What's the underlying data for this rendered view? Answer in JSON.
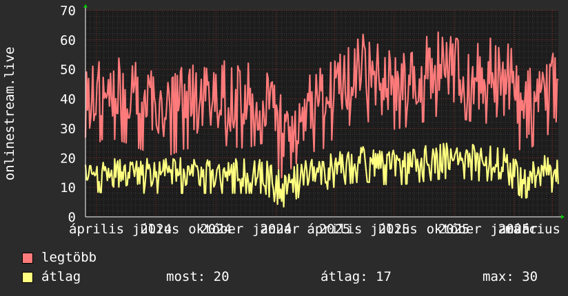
{
  "chart_data": {
    "type": "line",
    "ylabel": "onlinestream.live",
    "ylim": [
      0,
      70
    ],
    "yticks": [
      0,
      10,
      20,
      30,
      40,
      50,
      60,
      70
    ],
    "xlim": [
      "2024-03-15",
      "2026-03-10"
    ],
    "x_ticks": [
      {
        "date": "2024-04-01",
        "label": "április"
      },
      {
        "date": "2024-07-01",
        "label": "július"
      },
      {
        "date": "2024-07-01",
        "label": "2024"
      },
      {
        "date": "2024-10-01",
        "label": "október"
      },
      {
        "date": "2024-10-01",
        "label": "2024"
      },
      {
        "date": "2025-01-01",
        "label": "január"
      },
      {
        "date": "2025-01-01",
        "label": "2024"
      },
      {
        "date": "2025-04-01",
        "label": "április"
      },
      {
        "date": "2025-04-01",
        "label": "2025"
      },
      {
        "date": "2025-07-01",
        "label": "július"
      },
      {
        "date": "2025-07-01",
        "label": "2025"
      },
      {
        "date": "2025-10-01",
        "label": "október"
      },
      {
        "date": "2025-10-01",
        "label": "2025"
      },
      {
        "date": "2026-01-01",
        "label": "január"
      },
      {
        "date": "2026-01-01",
        "label": "2025"
      },
      {
        "date": "2026-03-01",
        "label": "március 2026"
      }
    ],
    "grid": true,
    "legend_placement": "bottom-left",
    "series": [
      {
        "name": "legtöbb",
        "color": "#ff7b7b",
        "points": [
          [
            "2024-03-15",
            38
          ],
          [
            "2024-04-15",
            44
          ],
          [
            "2024-05-15",
            42
          ],
          [
            "2024-06-15",
            39
          ],
          [
            "2024-07-15",
            37
          ],
          [
            "2024-08-15",
            40
          ],
          [
            "2024-09-15",
            39
          ],
          [
            "2024-10-15",
            41
          ],
          [
            "2024-11-15",
            40
          ],
          [
            "2024-12-15",
            42
          ],
          [
            "2025-01-10",
            30
          ],
          [
            "2025-02-15",
            38
          ],
          [
            "2025-03-15",
            40
          ],
          [
            "2025-04-15",
            47
          ],
          [
            "2025-05-15",
            50
          ],
          [
            "2025-06-15",
            46
          ],
          [
            "2025-07-15",
            47
          ],
          [
            "2025-08-15",
            49
          ],
          [
            "2025-09-15",
            52
          ],
          [
            "2025-10-15",
            50
          ],
          [
            "2025-11-15",
            48
          ],
          [
            "2025-12-15",
            52
          ],
          [
            "2026-01-15",
            37
          ],
          [
            "2026-02-15",
            45
          ],
          [
            "2026-03-10",
            44
          ]
        ]
      },
      {
        "name": "átlag",
        "color": "#ffff80",
        "points": [
          [
            "2024-03-15",
            16
          ],
          [
            "2024-04-15",
            15
          ],
          [
            "2024-05-15",
            15
          ],
          [
            "2024-06-15",
            15
          ],
          [
            "2024-07-15",
            15
          ],
          [
            "2024-08-15",
            15
          ],
          [
            "2024-09-15",
            15
          ],
          [
            "2024-10-15",
            15
          ],
          [
            "2024-11-15",
            15
          ],
          [
            "2024-12-15",
            15
          ],
          [
            "2025-01-10",
            10
          ],
          [
            "2025-02-15",
            15
          ],
          [
            "2025-03-15",
            16
          ],
          [
            "2025-04-15",
            18
          ],
          [
            "2025-05-15",
            19
          ],
          [
            "2025-06-15",
            18
          ],
          [
            "2025-07-15",
            18
          ],
          [
            "2025-08-15",
            19
          ],
          [
            "2025-09-15",
            20
          ],
          [
            "2025-10-15",
            20
          ],
          [
            "2025-11-15",
            19
          ],
          [
            "2025-12-15",
            20
          ],
          [
            "2026-01-15",
            13
          ],
          [
            "2026-02-15",
            16
          ],
          [
            "2026-03-10",
            15
          ]
        ]
      }
    ]
  },
  "legend": {
    "items": [
      {
        "label": "legtöbb",
        "color": "#ff7b7b"
      },
      {
        "label": "átlag",
        "color": "#ffff80"
      }
    ],
    "stats": {
      "most": "most: 20",
      "atlag": "átlag: 17",
      "max": "max: 30"
    }
  }
}
